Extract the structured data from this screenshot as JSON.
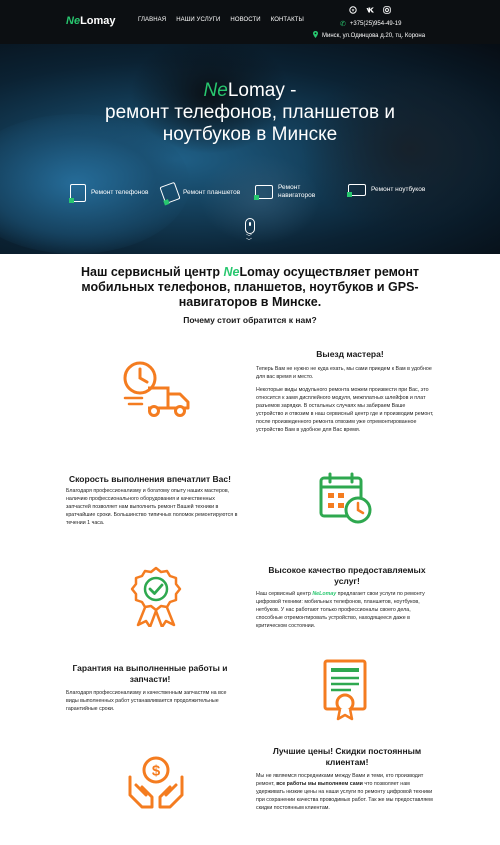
{
  "header": {
    "logo_prefix": "Ne",
    "logo_suffix": "Lomay",
    "nav": [
      "ГЛАВНАЯ",
      "НАШИ УСЛУГИ",
      "НОВОСТИ",
      "КОНТАКТЫ"
    ],
    "phone": "+375(25)954-49-19",
    "address": "Минск, ул.Одинцова д.20, тц. Корона",
    "social_icons": [
      "viber-icon",
      "vk-icon",
      "instagram-icon"
    ]
  },
  "hero": {
    "title_prefix": "Ne",
    "title_line1_rest": "Lomay -",
    "title_line2": "ремонт телефонов, планшетов и",
    "title_line3": "ноутбуков в Минске",
    "services": [
      {
        "line1": "Ремонт телефонов",
        "line2": ""
      },
      {
        "line1": "Ремонт планшетов",
        "line2": ""
      },
      {
        "line1": "Ремонт",
        "line2": "навигаторов"
      },
      {
        "line1": "Ремонт ноутбуков",
        "line2": ""
      }
    ]
  },
  "intro": {
    "part1": "Наш сервисный центр ",
    "ne": "Ne",
    "part2": "Lomay осуществляет ремонт",
    "line2": "мобильных телефонов, планшетов, ноутбуков и GPS-",
    "line3": "навигаторов в Минске."
  },
  "why": "Почему стоит обратится к нам?",
  "features": [
    {
      "title": "Выезд мастера!",
      "p1": "Теперь Вам не нужно не куда ехать, мы сами приедем к Вам в удобное для вас время и место.",
      "p2": "Некоторые виды модульного ремонта можем произвести при Вас, это относится к замя дисплейного модуля, межплатных шлейфов и плат разъемов зарядки. В остальных случаях мы забираем Ваше устройство и отвозим в наш сервисный центр где и производим ремонт, после произведенного ремонта отвозим уже отремонтированное устройство Вам в удобное для Вас время.",
      "icon": "delivery-truck-icon"
    },
    {
      "title": "Скорость выполнения впечатлит Вас!",
      "p1": "Благодаря профессионализму и богатому опыту наших мастеров, наличию профессионального оборудования и качественных запчастей позволяет нам выполнить ремонт Вашей техники в кратчайшие сроки. Большинство типичных поломок ремонтируются в течении 1 часа.",
      "icon": "calendar-clock-icon"
    },
    {
      "title": "Высокое качество предоставляемых услуг!",
      "p1_pre": "Наш сервисный центр ",
      "p1_ne": "Ne",
      "p1_brand": "Lomay",
      "p1_post": " предлагает свои услуги по ремонту цифровой техники: мобильных телефонов, планшетов, ноутбуков, нетбуков. У нас работают только профессионалы своего дела, способные отремонтировать устройство, находящееся даже в критическом состоянии.",
      "icon": "quality-badge-icon"
    },
    {
      "title": "Гарантия на выполненные работы и запчасти!",
      "p1": "Благодаря профессионализму и качественным запчастям на все виды выполненных работ устанавливается продолжительные гарантийные сроки.",
      "icon": "certificate-icon"
    },
    {
      "title": "Лучшие цены! Скидки постоянным клиентам!",
      "p1_pre": "Мы не являемся посредниками между Вами и теми, кто производит ремонт, ",
      "p1_bold": "все работы мы выполняем сами",
      "p1_post": " что позволяет нам удерживать низкие цены на наши услуги по ремонту цифровой техники при сохранении качества проводимых работ. Так же мы предоставляем скидки постоянным клиентам.",
      "icon": "money-hands-icon"
    }
  ],
  "colors": {
    "accent": "#28c76f",
    "icon_orange": "#f47c20",
    "icon_green": "#2ea84f",
    "header_bg": "#0c0f12"
  }
}
